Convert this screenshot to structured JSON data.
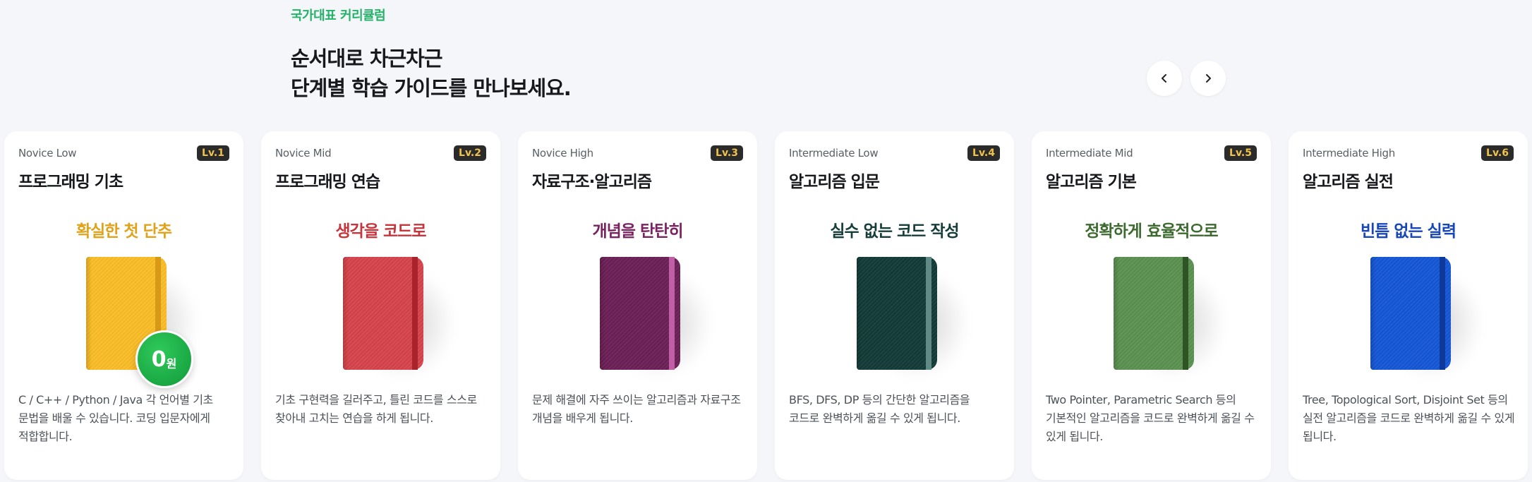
{
  "header": {
    "eyebrow": "국가대표 커리큘럼",
    "headline_line1": "순서대로 차근차근",
    "headline_line2": "단계별 학습 가이드를 만나보세요."
  },
  "nav": {
    "prev_icon": "chevron-left-icon",
    "next_icon": "chevron-right-icon"
  },
  "cards": [
    {
      "level": "Novice Low",
      "badge": "Lv.1",
      "title": "프로그래밍 기초",
      "slogan": "확실한 첫 단추",
      "slogan_color": "#e0a21a",
      "book_color": "#fbbd26",
      "band_color": "#d89a16",
      "price_num": "0",
      "price_unit": "원",
      "desc": "C / C++ / Python / Java 각 언어별 기초 문법을 배울 수 있습니다. 코딩 입문자에게 적합합니다."
    },
    {
      "level": "Novice Mid",
      "badge": "Lv.2",
      "title": "프로그래밍 연습",
      "slogan": "생각을 코드로",
      "slogan_color": "#c7353c",
      "book_color": "#d6434a",
      "band_color": "#a8232b",
      "desc": "기초 구현력을 길러주고, 틀린 코드를 스스로 찾아내 고치는 연습을 하게 됩니다."
    },
    {
      "level": "Novice High",
      "badge": "Lv.3",
      "title": "자료구조·알고리즘",
      "slogan": "개념을 탄탄히",
      "slogan_color": "#7b2262",
      "book_color": "#6b1f55",
      "band_color": "#c25fa4",
      "desc": "문제 해결에 자주 쓰이는 알고리즘과 자료구조 개념을 배우게 됩니다."
    },
    {
      "level": "Intermediate Low",
      "badge": "Lv.4",
      "title": "알고리즘 입문",
      "slogan": "실수 없는 코드 작성",
      "slogan_color": "#153d3a",
      "book_color": "#123a37",
      "band_color": "#5f8a86",
      "desc": "BFS, DFS, DP 등의 간단한 알고리즘을 코드로 완벽하게 옮길 수 있게 됩니다."
    },
    {
      "level": "Intermediate Mid",
      "badge": "Lv.5",
      "title": "알고리즘 기본",
      "slogan": "정확하게 효율적으로",
      "slogan_color": "#3d6b2f",
      "book_color": "#5b9150",
      "band_color": "#2e5426",
      "desc": "Two Pointer, Parametric Search 등의 기본적인 알고리즘을 코드로 완벽하게 옮길 수 있게 됩니다."
    },
    {
      "level": "Intermediate High",
      "badge": "Lv.6",
      "title": "알고리즘 실전",
      "slogan": "빈틈 없는 실력",
      "slogan_color": "#1746b8",
      "book_color": "#1456d6",
      "band_color": "#0d3a9a",
      "desc": "Tree, Topological Sort, Disjoint Set 등의 실전 알고리즘을 코드로 완벽하게 옮길 수 있게 됩니다."
    }
  ]
}
